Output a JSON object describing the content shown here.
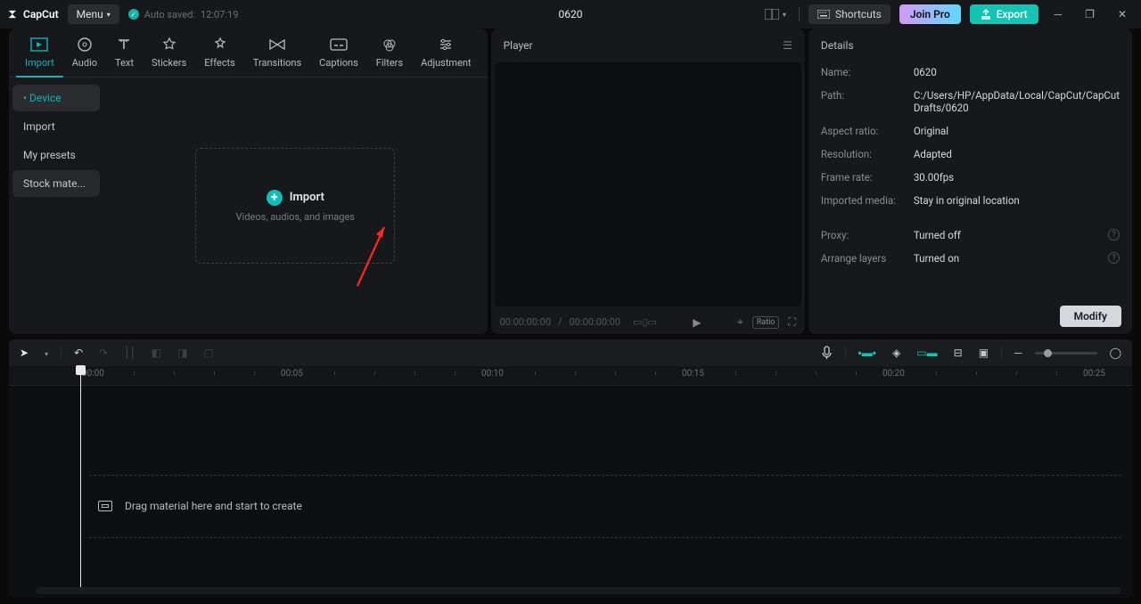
{
  "titlebar": {
    "app_name": "CapCut",
    "menu": "Menu",
    "autosave_prefix": "Auto saved:",
    "autosave_time": "12:07:19",
    "project": "0620",
    "shortcuts": "Shortcuts",
    "join_pro": "Join Pro",
    "export": "Export"
  },
  "tool_tabs": [
    "Import",
    "Audio",
    "Text",
    "Stickers",
    "Effects",
    "Transitions",
    "Captions",
    "Filters",
    "Adjustment"
  ],
  "side_nav": [
    "Device",
    "Import",
    "My presets",
    "Stock mate..."
  ],
  "import_box": {
    "label": "Import",
    "sub": "Videos, audios, and images"
  },
  "player": {
    "title": "Player",
    "time_cur": "00:00:00:00",
    "time_sep": " / ",
    "time_dur": "00:00:00:00",
    "ratio": "Ratio"
  },
  "details": {
    "title": "Details",
    "name_l": "Name:",
    "name_v": "0620",
    "path_l": "Path:",
    "path_v": "C:/Users/HP/AppData/Local/CapCut/CapCut Drafts/0620",
    "aspect_l": "Aspect ratio:",
    "aspect_v": "Original",
    "res_l": "Resolution:",
    "res_v": "Adapted",
    "fps_l": "Frame rate:",
    "fps_v": "30.00fps",
    "impmedia_l": "Imported media:",
    "impmedia_v": "Stay in original location",
    "proxy_l": "Proxy:",
    "proxy_v": "Turned off",
    "layers_l": "Arrange layers",
    "layers_v": "Turned on",
    "modify": "Modify"
  },
  "ruler": [
    "00:00",
    "00:05",
    "00:10",
    "00:15",
    "00:20",
    "00:25"
  ],
  "timeline_hint": "Drag material here and start to create"
}
